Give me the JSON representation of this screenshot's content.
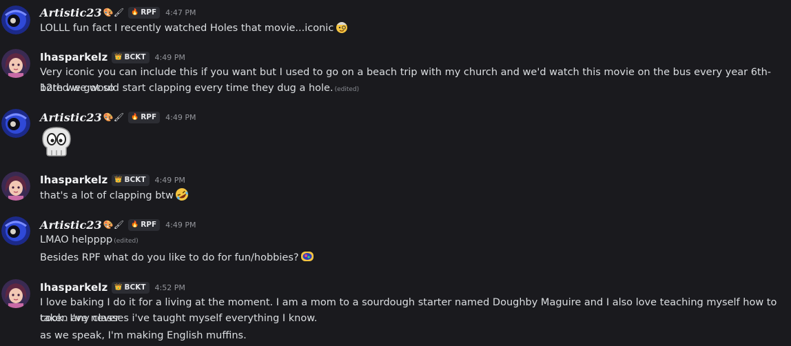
{
  "users": {
    "artistic": {
      "name": "Artistic23",
      "deco": "🎨🖌",
      "tag_icon": "🔥",
      "tag": "RPF"
    },
    "ihas": {
      "name": "Ihasparkelz",
      "tag_icon": "👑",
      "tag": "BCKT"
    }
  },
  "messages": [
    {
      "user": "Artistic23",
      "time": "4:47 PM",
      "lines": [
        "LOLLL fun fact I recently watched Holes that movie...iconic"
      ],
      "emoji": "face-with-monocle-cowboy"
    },
    {
      "user": "Ihasparkelz",
      "time": "4:49 PM",
      "lines": [
        "Very iconic you can include this if you want but I used to go on a beach trip with my church and we'd watch this movie on the bus every year 6th-12th we got so",
        "bored we would start clapping every time they dug a hole."
      ],
      "edited": "(edited)"
    },
    {
      "user": "Artistic23",
      "time": "4:49 PM",
      "big_emoji": "skull-emoji"
    },
    {
      "user": "Ihasparkelz",
      "time": "4:49 PM",
      "lines": [
        "that's a lot of clapping btw"
      ],
      "emoji": "rolling-laughing-emoji"
    },
    {
      "user": "Artistic23",
      "time": "4:49 PM",
      "lines": [
        "LMAO helpppp",
        "Besides RPF what do you like to do for fun/hobbies?"
      ],
      "edited": "(edited)",
      "emoji": "custom-emoji"
    },
    {
      "user": "Ihasparkelz",
      "time": "4:52 PM",
      "lines": [
        "I love baking I do it for a living at the moment. I am a mom to a sourdough starter named Doughby Maguire and I also love teaching myself how to cook. I've never",
        "taken any classes i've taught myself everything I know.",
        "as we speak, I'm making English muffins."
      ]
    }
  ]
}
